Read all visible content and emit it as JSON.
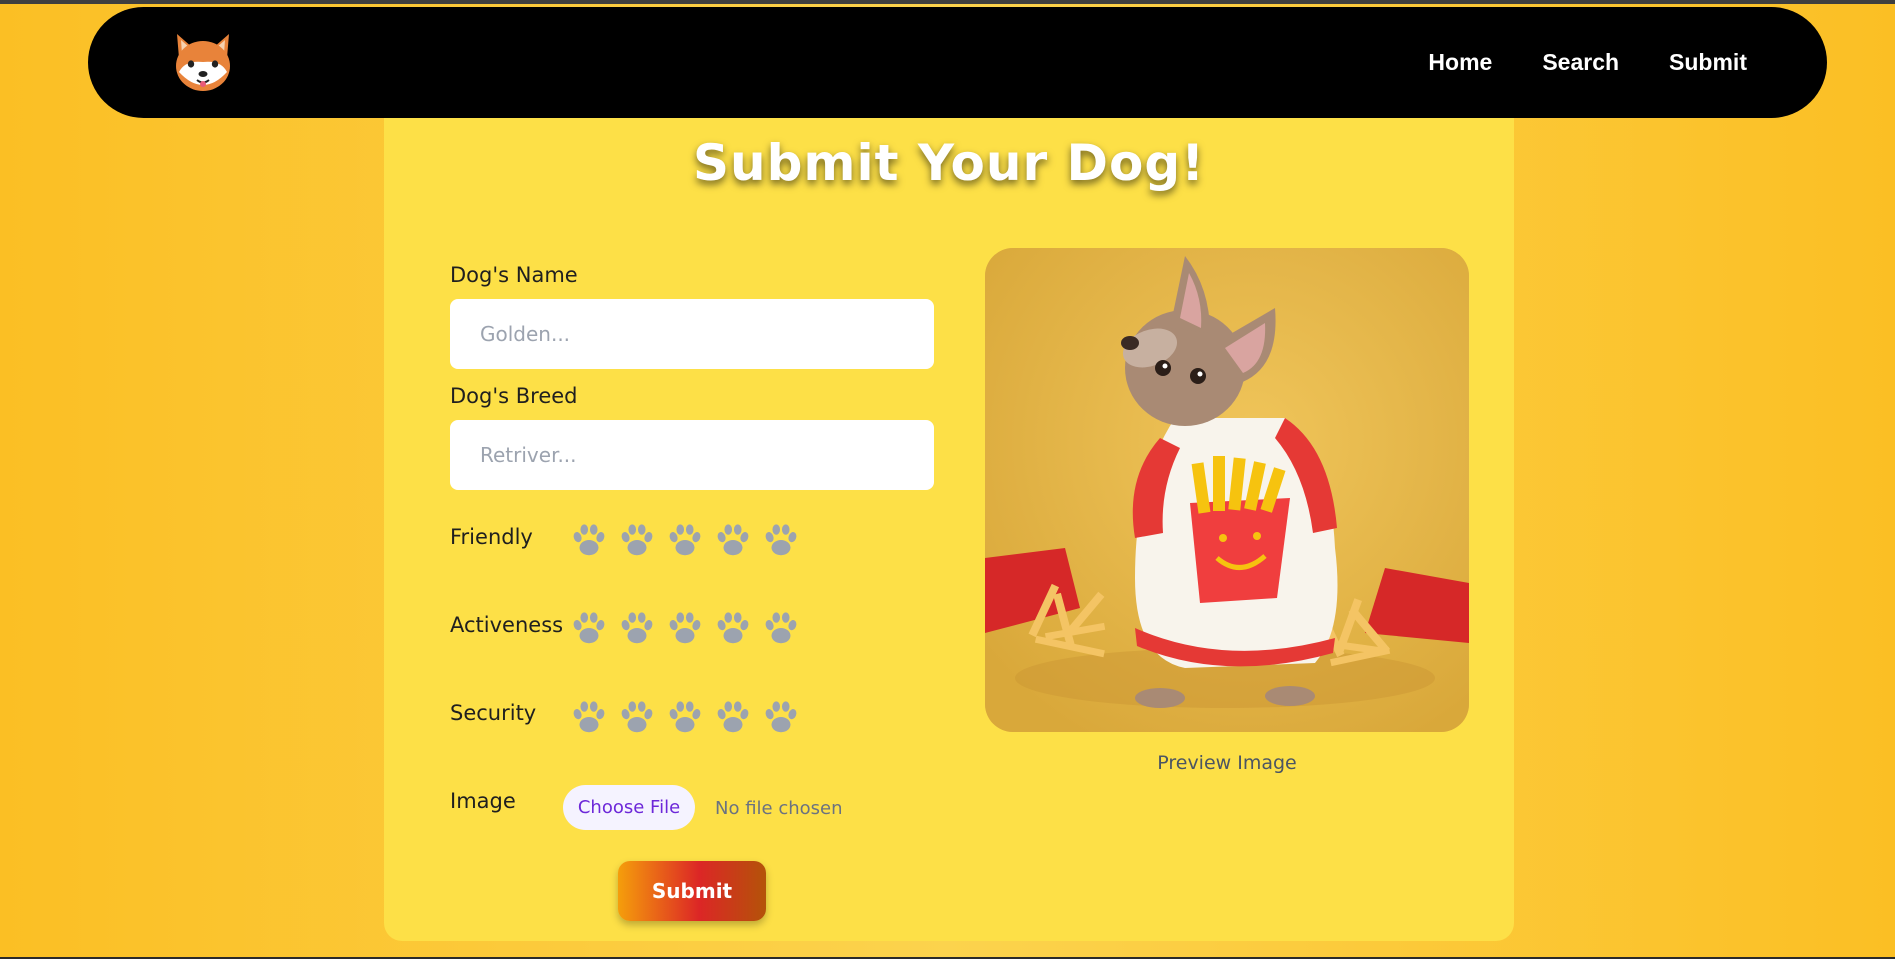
{
  "nav": {
    "logo_alt": "shiba dog logo",
    "links": [
      "Home",
      "Search",
      "Submit"
    ]
  },
  "form": {
    "title": "Submit Your Dog!",
    "name_label": "Dog's Name",
    "name_placeholder": "Golden...",
    "breed_label": "Dog's Breed",
    "breed_placeholder": "Retriver...",
    "ratings": [
      {
        "label": "Friendly",
        "value": 0,
        "max": 5
      },
      {
        "label": "Activeness",
        "value": 0,
        "max": 5
      },
      {
        "label": "Security",
        "value": 0,
        "max": 5
      }
    ],
    "image_label": "Image",
    "choose_file": "Choose File",
    "no_file": "No file chosen",
    "submit": "Submit"
  },
  "preview": {
    "caption": "Preview Image"
  },
  "colors": {
    "background": "#fbbf24",
    "panel": "#fde047",
    "navbar": "#000000",
    "paw": "#9ca3af",
    "file_button_text": "#6d28d9",
    "submit_gradient_start": "#f59e0b",
    "submit_gradient_end": "#dc2626"
  },
  "icons": {
    "logo": "shiba-dog-icon",
    "rating": "paw-icon"
  }
}
